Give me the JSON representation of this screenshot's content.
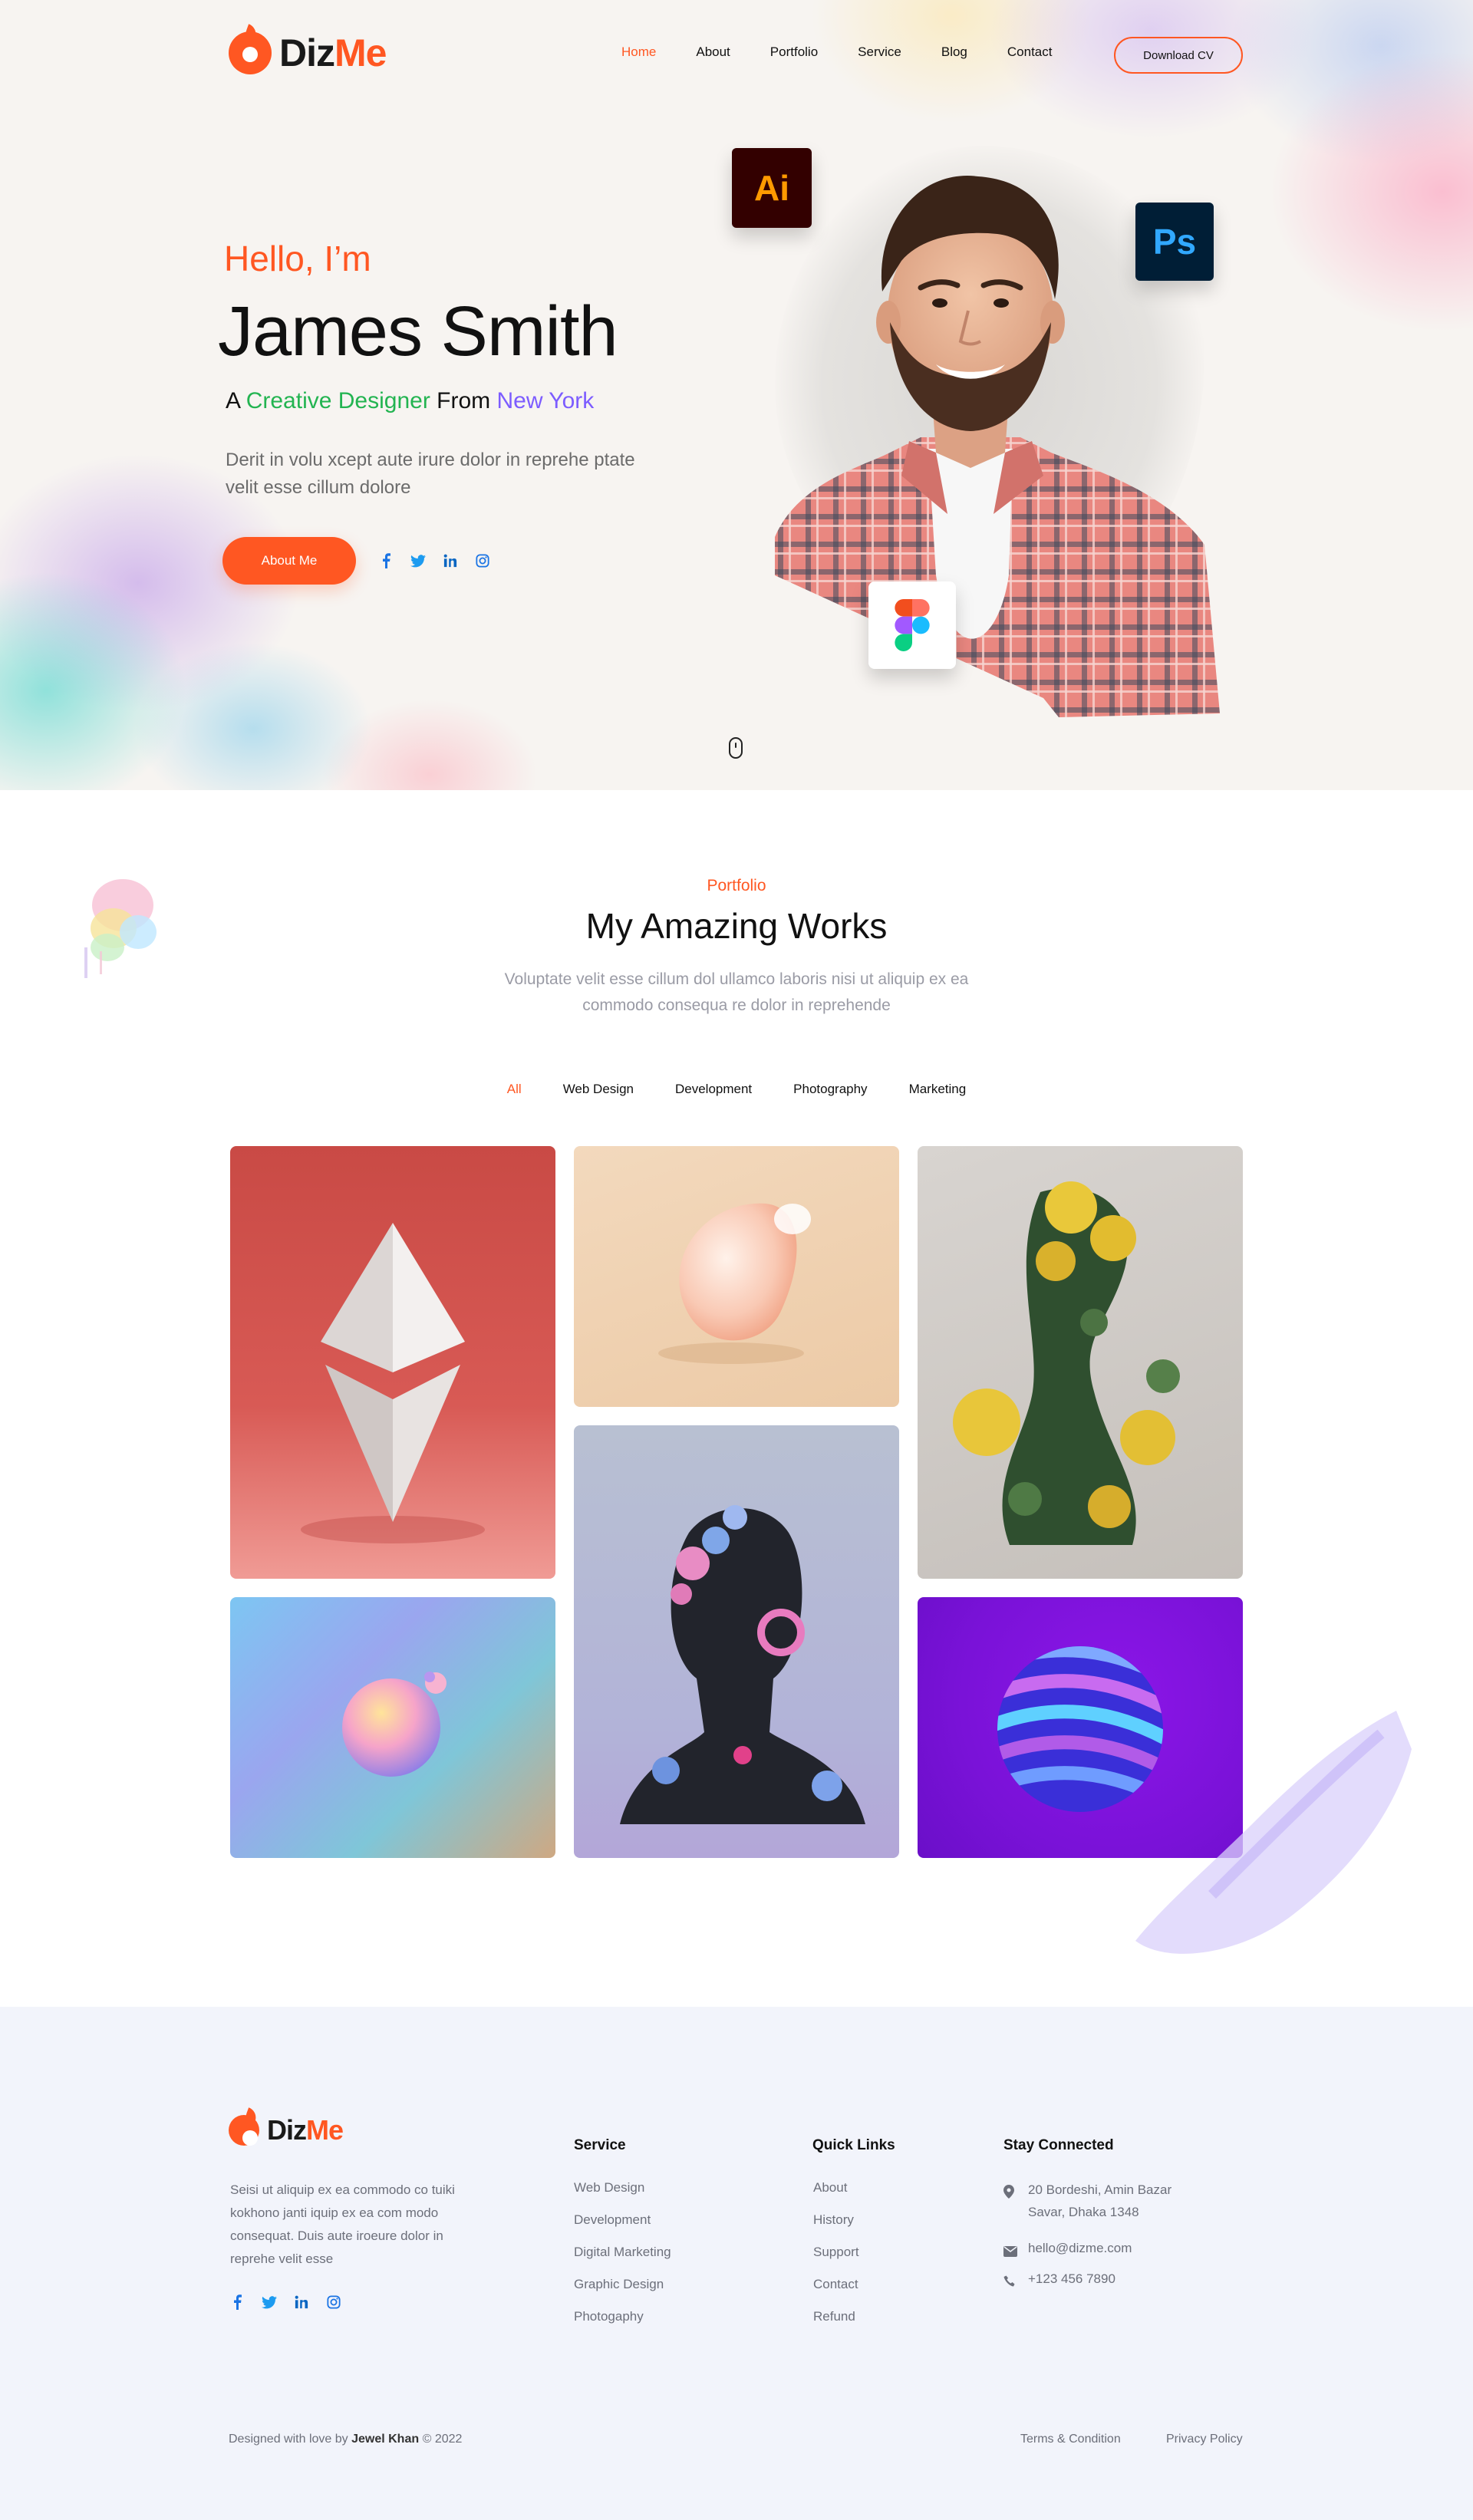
{
  "brand": {
    "name_part1": "Diz",
    "name_part2": "Me",
    "accent": "#ff5722"
  },
  "nav": {
    "items": [
      {
        "label": "Home",
        "active": true
      },
      {
        "label": "About"
      },
      {
        "label": "Portfolio"
      },
      {
        "label": "Service"
      },
      {
        "label": "Blog"
      },
      {
        "label": "Contact"
      }
    ],
    "cta": "Download CV"
  },
  "hero": {
    "greeting": "Hello, I’m",
    "name": "James Smith",
    "tagline": {
      "prefix": "A",
      "role": "Creative Designer",
      "from": "From",
      "city": "New York"
    },
    "description": "Derit in volu xcept aute irure dolor in reprehe ptate velit esse cillum dolore",
    "button": "About Me",
    "socials": [
      "facebook-icon",
      "twitter-icon",
      "linkedin-icon",
      "instagram-icon"
    ],
    "tool_badges": {
      "illustrator": "Ai",
      "photoshop": "Ps",
      "figma": "figma-icon"
    }
  },
  "portfolio": {
    "eyebrow": "Portfolio",
    "title": "My Amazing Works",
    "description": "Voluptate velit esse cillum dol ullamco laboris nisi ut aliquip ex ea commodo consequa re dolor in reprehende",
    "filters": [
      {
        "label": "All",
        "active": true
      },
      {
        "label": "Web Design"
      },
      {
        "label": "Development"
      },
      {
        "label": "Photography"
      },
      {
        "label": "Marketing"
      }
    ],
    "items": [
      "ethereum-3d",
      "pastel-egg",
      "flower-bust",
      "face-sculpture",
      "gradient-sphere",
      "striped-sphere"
    ]
  },
  "footer": {
    "about": "Seisi ut aliquip ex ea commodo co tuiki kokhono janti iquip ex ea com modo consequat. Duis aute iroeure dolor in reprehe velit esse",
    "service": {
      "title": "Service",
      "items": [
        "Web Design",
        "Development",
        "Digital Marketing",
        "Graphic Design",
        "Photogaphy"
      ]
    },
    "quick_links": {
      "title": "Quick Links",
      "items": [
        "About",
        "History",
        "Support",
        "Contact",
        "Refund"
      ]
    },
    "stay_connected": {
      "title": "Stay Connected",
      "address_line1": "20 Bordeshi, Amin Bazar",
      "address_line2": "Savar, Dhaka 1348",
      "email": "hello@dizme.com",
      "phone": "+123 456 7890"
    },
    "copyright": {
      "prefix": "Designed with love by",
      "author": "Jewel Khan",
      "year": "©  2022"
    },
    "legal": {
      "terms": "Terms & Condition",
      "privacy": "Privacy Policy"
    }
  }
}
